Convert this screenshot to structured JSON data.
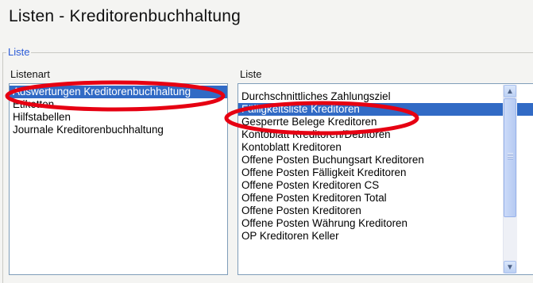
{
  "header": {
    "title": "Listen - Kreditorenbuchhaltung"
  },
  "group": {
    "label": "Liste"
  },
  "listenart": {
    "label": "Listenart",
    "items": [
      "Auswertungen Kreditorenbuchhaltung",
      "Etiketten",
      "Hilfstabellen",
      "Journale Kreditorenbuchhaltung"
    ],
    "selected_index": 0
  },
  "liste": {
    "label": "Liste",
    "items": [
      "Durchschnittliches Zahlungsziel",
      "Fälligkeitsliste Kreditoren",
      "Gesperrte Belege Kreditoren",
      "Kontoblatt Kreditoren/Debitoren",
      "Kontoblatt Kreditoren",
      "Offene Posten Buchungsart Kreditoren",
      "Offene Posten Fälligkeit Kreditoren",
      "Offene Posten Kreditoren CS",
      "Offene Posten Kreditoren Total",
      "Offene Posten Kreditoren",
      "Offene Posten Währung Kreditoren",
      "OP Kreditoren Keller"
    ],
    "selected_index": 1
  },
  "scrollbar": {
    "up_icon": "▲",
    "down_icon": "▼"
  },
  "colors": {
    "highlight_ring": "#e60012",
    "selection": "#316ac5",
    "group_label": "#2b5bd7"
  }
}
